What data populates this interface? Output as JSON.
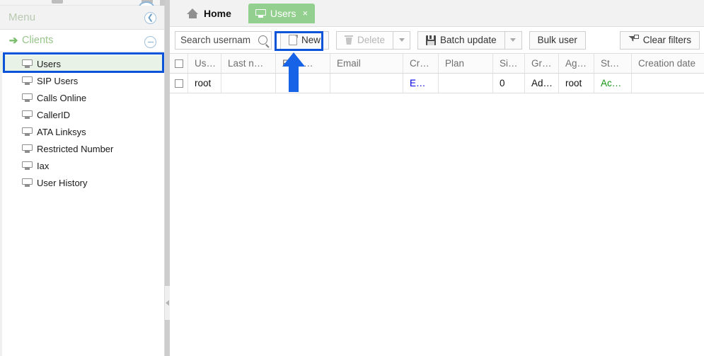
{
  "sidebar": {
    "header_title": "Menu",
    "collapse_icon": "chevron-left-circle-icon",
    "group": {
      "label": "Clients",
      "arrow_icon": "arrow-right-icon",
      "collapse_icon": "minus-circle-icon"
    },
    "items": [
      {
        "label": "Users",
        "icon": "monitor-icon",
        "selected": true
      },
      {
        "label": "SIP Users",
        "icon": "monitor-icon",
        "selected": false
      },
      {
        "label": "Calls Online",
        "icon": "monitor-icon",
        "selected": false
      },
      {
        "label": "CallerID",
        "icon": "monitor-icon",
        "selected": false
      },
      {
        "label": "ATA Linksys",
        "icon": "monitor-icon",
        "selected": false
      },
      {
        "label": "Restricted Number",
        "icon": "monitor-icon",
        "selected": false
      },
      {
        "label": "Iax",
        "icon": "monitor-icon",
        "selected": false
      },
      {
        "label": "User History",
        "icon": "monitor-icon",
        "selected": false
      }
    ]
  },
  "tabs": [
    {
      "label": "Home",
      "icon": "home-icon",
      "active": false,
      "closable": false
    },
    {
      "label": "Users",
      "icon": "monitor-icon",
      "active": true,
      "closable": true,
      "close_glyph": "×"
    }
  ],
  "toolbar": {
    "search_placeholder": "Search usernam",
    "search_value": "",
    "search_icon": "magnifier-icon",
    "new_label": "New",
    "new_icon": "document-icon",
    "delete_label": "Delete",
    "delete_icon": "trash-icon",
    "delete_disabled": true,
    "batch_update_label": "Batch update",
    "batch_update_icon": "floppy-disk-icon",
    "bulk_user_label": "Bulk user",
    "clear_filters_label": "Clear filters",
    "clear_filters_icon": "funnel-clear-icon",
    "dropdown_icon": "chevron-down-icon"
  },
  "grid": {
    "columns": [
      {
        "label": "",
        "key": "checkbox"
      },
      {
        "label": "Us…",
        "key": "username"
      },
      {
        "label": "Last n…",
        "key": "lastname"
      },
      {
        "label": "First …",
        "key": "firstname"
      },
      {
        "label": "Email",
        "key": "email"
      },
      {
        "label": "Cr…",
        "key": "credit"
      },
      {
        "label": "Plan",
        "key": "plan"
      },
      {
        "label": "Si…",
        "key": "sip"
      },
      {
        "label": "Gr…",
        "key": "group"
      },
      {
        "label": "Ag…",
        "key": "agent"
      },
      {
        "label": "St…",
        "key": "status"
      },
      {
        "label": "Creation date",
        "key": "creation_date"
      }
    ],
    "rows": [
      {
        "checkbox": "",
        "username": "root",
        "lastname": "",
        "firstname": "",
        "email": "",
        "credit": "E…",
        "plan": "",
        "sip": "0",
        "group": "Ad…",
        "agent": "root",
        "status": "Ac…",
        "creation_date": ""
      }
    ]
  },
  "annotation": {
    "pointer_icon": "up-arrow-cursor",
    "pointer_color": "#1663e8",
    "highlight_color": "#0b53d9"
  }
}
